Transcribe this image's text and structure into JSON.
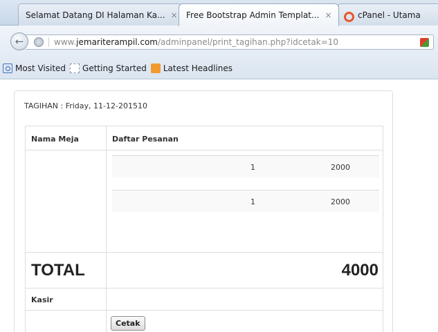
{
  "browser": {
    "tabs": [
      {
        "label": "Selamat Datang DI Halaman Ka...",
        "close": "×"
      },
      {
        "label": "Free Bootstrap Admin Templat...",
        "close": "×"
      },
      {
        "label": "cPanel - Utama"
      }
    ],
    "active_tab": 1,
    "url": {
      "prefix": "www.",
      "domain": "jemariterampil.com",
      "path": "/adminpanel/print_tagihan.php?idcetak=10"
    },
    "bookmarks": [
      {
        "label": "Most Visited",
        "icon": "most-visited-icon"
      },
      {
        "label": "Getting Started",
        "icon": "page-icon"
      },
      {
        "label": "Latest Headlines",
        "icon": "rss-icon"
      }
    ]
  },
  "page": {
    "title": "TAGIHAN : Friday, 11-12-201510",
    "table": {
      "col_headers": [
        "Nama Meja",
        "Daftar Pesanan"
      ],
      "items": [
        {
          "qty": "1",
          "price": "2000"
        },
        {
          "qty": "1",
          "price": "2000"
        }
      ],
      "total_label": "TOTAL",
      "total_value": "4000",
      "kasir_label": "Kasir",
      "print_button": "Cetak"
    }
  }
}
